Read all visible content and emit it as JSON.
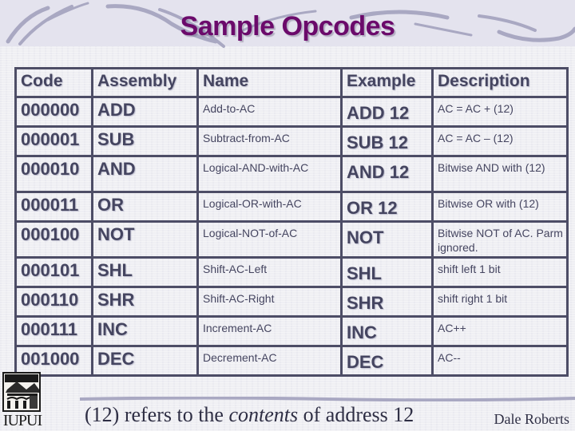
{
  "slide": {
    "title": "Sample Opcodes",
    "title_color": "#6b0a6b",
    "footnote": {
      "prefix": "(12) refers to the ",
      "emphasis": "contents",
      "suffix": " of address 12"
    },
    "author": "Dale Roberts",
    "logo_text": "IUPUI"
  },
  "table": {
    "headers": [
      "Code",
      "Assembly",
      "Name",
      "Example",
      "Description"
    ],
    "rows": [
      {
        "code": "000000",
        "assembly": "ADD",
        "name": "Add-to-AC",
        "example": "ADD 12",
        "description": "AC = AC + (12)"
      },
      {
        "code": "000001",
        "assembly": "SUB",
        "name": "Subtract-from-AC",
        "example": "SUB 12",
        "description": "AC = AC – (12)"
      },
      {
        "code": "000010",
        "assembly": "AND",
        "name": "Logical-AND-with-AC",
        "example": "AND 12",
        "description": "Bitwise AND with (12)"
      },
      {
        "code": "000011",
        "assembly": "OR",
        "name": "Logical-OR-with-AC",
        "example": "OR 12",
        "description": "Bitwise OR with (12)"
      },
      {
        "code": "000100",
        "assembly": "NOT",
        "name": "Logical-NOT-of-AC",
        "example": "NOT",
        "description": "Bitwise NOT of AC. Parm ignored."
      },
      {
        "code": "000101",
        "assembly": "SHL",
        "name": "Shift-AC-Left",
        "example": "SHL",
        "description": "shift left 1 bit"
      },
      {
        "code": "000110",
        "assembly": "SHR",
        "name": "Shift-AC-Right",
        "example": "SHR",
        "description": "shift right 1 bit"
      },
      {
        "code": "000111",
        "assembly": "INC",
        "name": "Increment-AC",
        "example": "INC",
        "description": "AC++"
      },
      {
        "code": "001000",
        "assembly": "DEC",
        "name": "Decrement-AC",
        "example": "DEC",
        "description": "AC--"
      }
    ]
  }
}
